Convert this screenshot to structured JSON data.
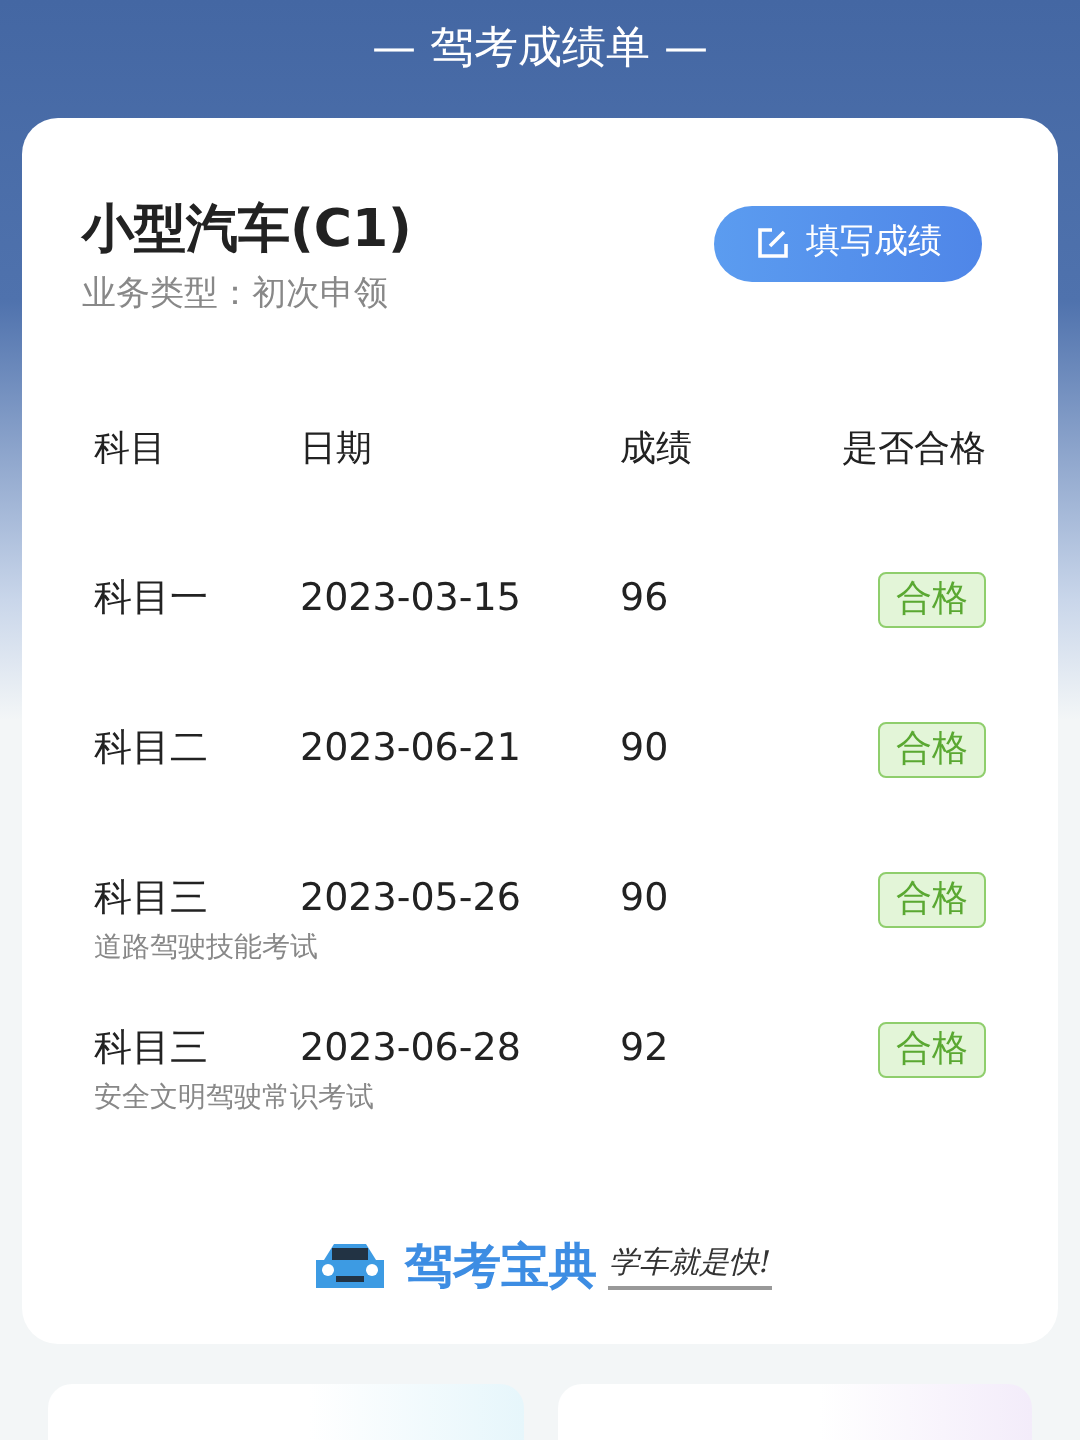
{
  "header": {
    "title": "— 驾考成绩单 —"
  },
  "card": {
    "vehicle": "小型汽车(C1)",
    "business_type": "业务类型：初次申领",
    "button": "填写成绩",
    "columns": [
      "科目",
      "日期",
      "成绩",
      "是否合格"
    ],
    "rows": [
      {
        "subject": "科目一",
        "date": "2023-03-15",
        "score": "96",
        "result": "合格",
        "passed": true
      },
      {
        "subject": "科目二",
        "date": "2023-06-21",
        "score": "90",
        "result": "合格",
        "passed": true
      },
      {
        "subject": "科目三",
        "date": "2023-05-26",
        "score": "90",
        "result": "合格",
        "passed": true,
        "note": "道路驾驶技能考试"
      },
      {
        "subject": "科目三",
        "date": "2023-06-28",
        "score": "92",
        "result": "合格",
        "passed": true,
        "note": "安全文明驾驶常识考试"
      }
    ],
    "brand": {
      "name": "驾考宝典",
      "slogan": "学车就是快!"
    }
  }
}
